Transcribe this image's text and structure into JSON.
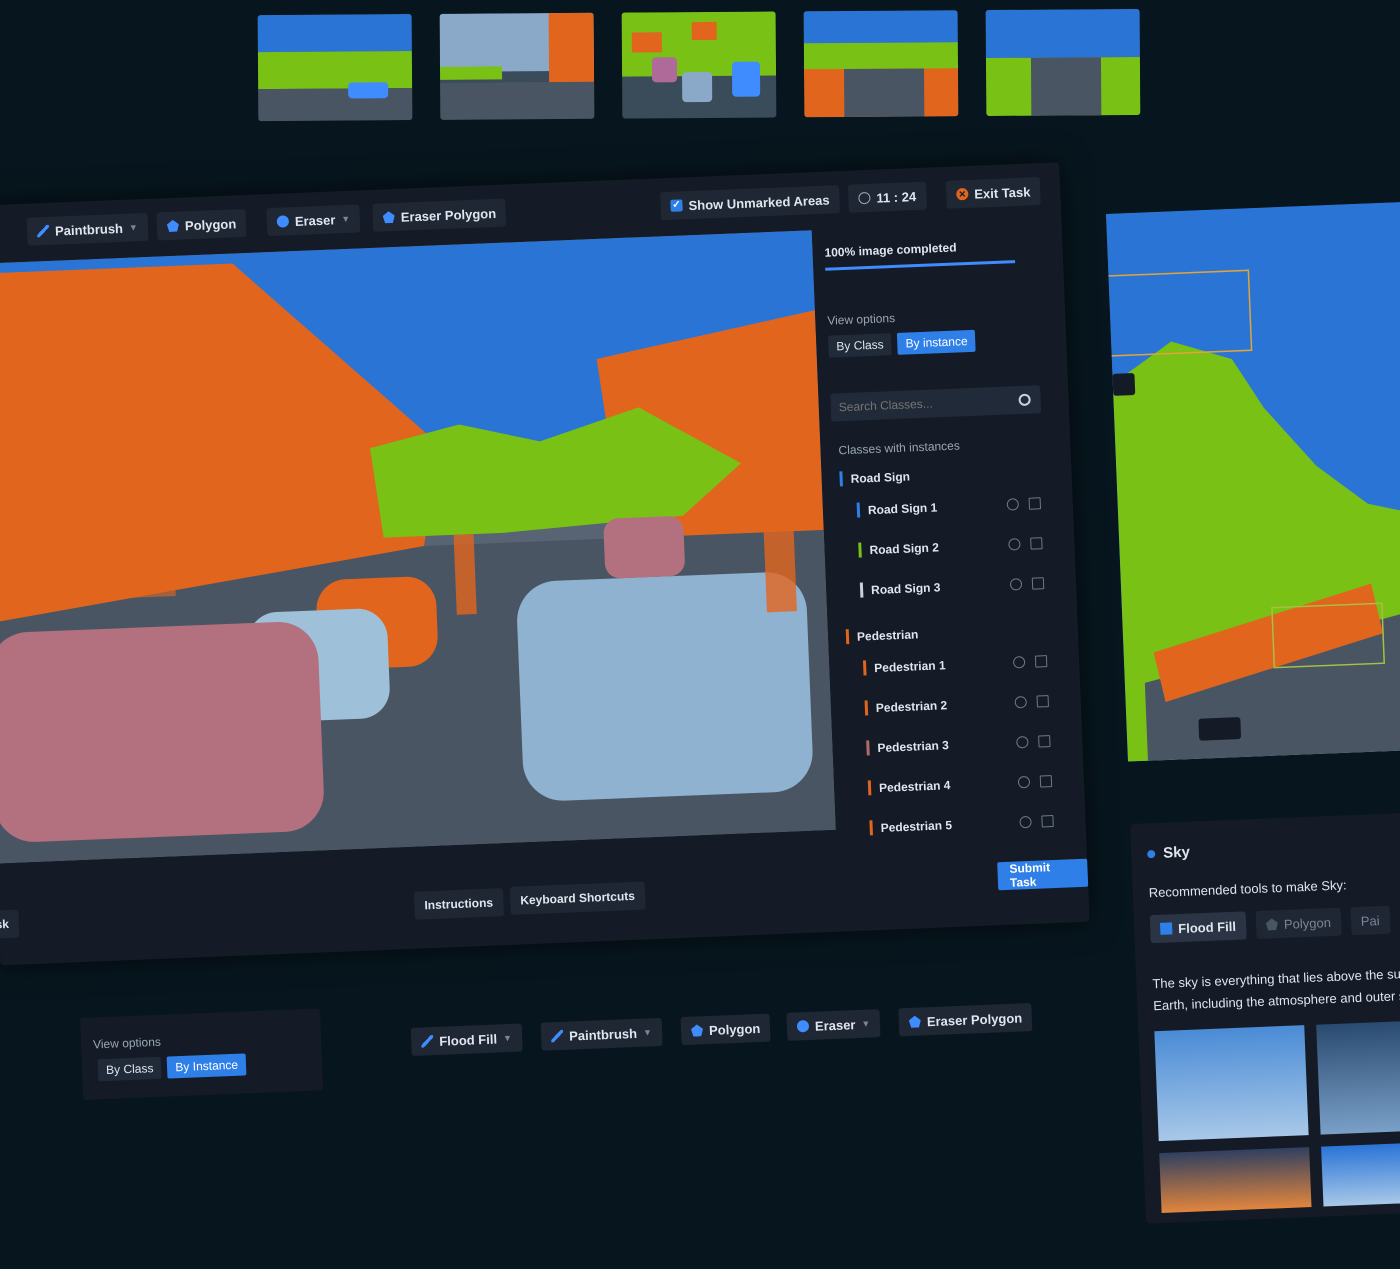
{
  "toolbar": {
    "paintbrush": "Paintbrush",
    "polygon": "Polygon",
    "eraser": "Eraser",
    "eraser_polygon": "Eraser Polygon",
    "show_unmarked": "Show Unmarked Areas",
    "timer": "11 : 24",
    "exit": "Exit Task"
  },
  "sidebar": {
    "progress_label": "100% image completed",
    "progress_value": 1.0,
    "view_options_label": "View options",
    "by_class": "By Class",
    "by_instance": "By instance",
    "search_placeholder": "Search Classes...",
    "classes_label": "Classes with instances",
    "groups": [
      {
        "name": "Road Sign",
        "color": "#2f7fe8",
        "instances": [
          {
            "name": "Road Sign 1",
            "color": "#2f7fe8"
          },
          {
            "name": "Road Sign 2",
            "color": "#79c115"
          },
          {
            "name": "Road Sign 3",
            "color": "#c8d2de"
          }
        ]
      },
      {
        "name": "Pedestrian",
        "color": "#e2651e",
        "instances": [
          {
            "name": "Pedestrian 1",
            "color": "#e2651e"
          },
          {
            "name": "Pedestrian 2",
            "color": "#e2651e"
          },
          {
            "name": "Pedestrian 3",
            "color": "#b06a6a"
          },
          {
            "name": "Pedestrian 4",
            "color": "#e2651e"
          },
          {
            "name": "Pedestrian 5",
            "color": "#e2651e"
          }
        ]
      }
    ]
  },
  "footer": {
    "left_partial": "ask",
    "instructions": "Instructions",
    "shortcuts": "Keyboard Shortcuts",
    "submit": "Submit Task"
  },
  "sky_panel": {
    "title": "Sky",
    "recommended": "Recommended tools to make Sky:",
    "tools": [
      "Flood Fill",
      "Polygon",
      "Pai"
    ],
    "description_line1": "The sky is everything that lies above the surf",
    "description_line2": "Earth, including the atmosphere and outer s"
  },
  "view_options_card": {
    "label": "View options",
    "by_class": "By Class",
    "by_instance": "By Instance"
  },
  "bottom_tools": {
    "flood_fill": "Flood Fill",
    "paintbrush": "Paintbrush",
    "polygon": "Polygon",
    "eraser": "Eraser",
    "eraser_polygon": "Eraser Polygon"
  },
  "colors": {
    "accent": "#2f7fe8",
    "sky": "#2a74d6",
    "vegetation": "#79c115",
    "building": "#e2651e",
    "road": "#4a5563"
  }
}
